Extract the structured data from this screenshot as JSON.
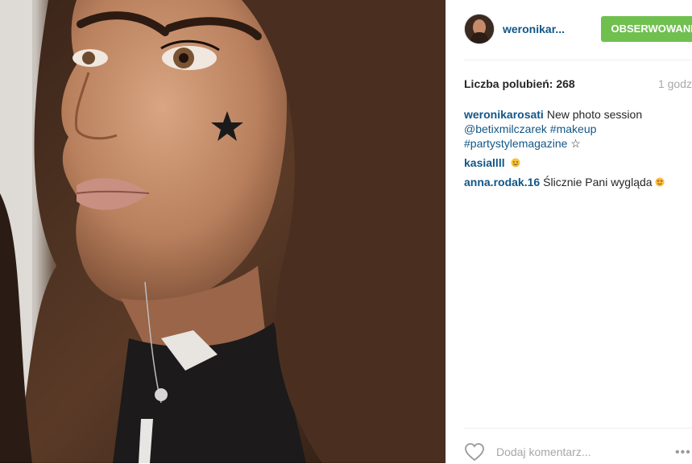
{
  "post": {
    "image_alt": "Portrait photo with a star on the cheek",
    "username": "weronikar...",
    "follow_label": "OBSERWOWANIE",
    "likes_text": "Liczba polubień: 268",
    "time_text": "1 godz",
    "comments": [
      {
        "author": "weronikarosati",
        "text_parts": [
          "New photo session",
          "@betixmilczarek",
          "#makeup",
          "#partystylemagazine",
          "☆"
        ]
      },
      {
        "author": "kasiallll",
        "emoji": "smiling-face-emoji"
      },
      {
        "author": "anna.rodak.16",
        "text": "Ślicznie Pani wygląda",
        "emoji": "heart-eyes-emoji"
      }
    ],
    "comment_placeholder": "Dodaj komentarz...",
    "more_icon": "more-options-icon",
    "like_icon": "heart-icon"
  },
  "colors": {
    "follow_bg": "#70c050",
    "username": "#125688",
    "muted": "#a5a7aa"
  }
}
